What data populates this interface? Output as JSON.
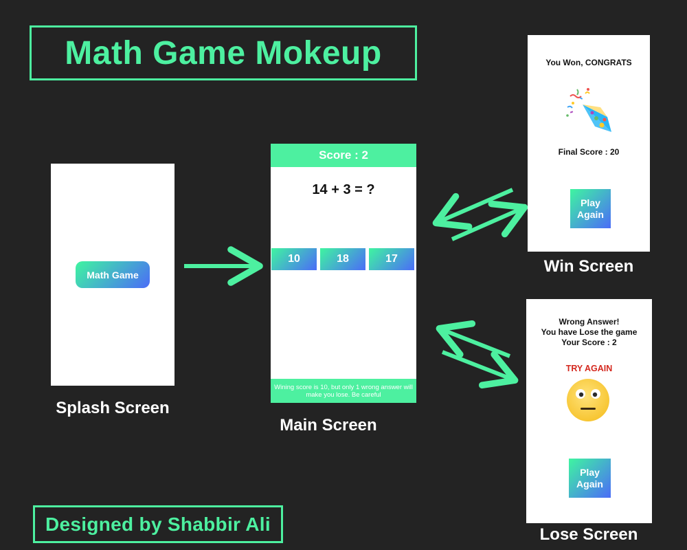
{
  "title": "Math Game Mokeup",
  "credit": "Designed by Shabbir Ali",
  "splash": {
    "button_label": "Math Game",
    "caption": "Splash Screen"
  },
  "main": {
    "score_label": "Score : 2",
    "question": "14 + 3 = ?",
    "answers": [
      "10",
      "18",
      "17"
    ],
    "footer": "Wining score is 10, but only 1 wrong answer will make you lose. Be careful",
    "caption": "Main Screen"
  },
  "win": {
    "message": "You Won, CONGRATS",
    "final_score": "Final Score : 20",
    "button_label": "Play Again",
    "caption": "Win Screen",
    "icon": "party-popper-icon"
  },
  "lose": {
    "line1": "Wrong Answer!",
    "line2": "You have Lose the game",
    "line3": "Your Score : 2",
    "try_again": "TRY AGAIN",
    "button_label": "Play Again",
    "caption": "Lose Screen",
    "icon": "neutral-face-icon"
  },
  "colors": {
    "background": "#232323",
    "accent": "#4df0a0",
    "gradient_start": "#3ff5a0",
    "gradient_end": "#4b6cf7",
    "try_again_red": "#d4281e"
  }
}
